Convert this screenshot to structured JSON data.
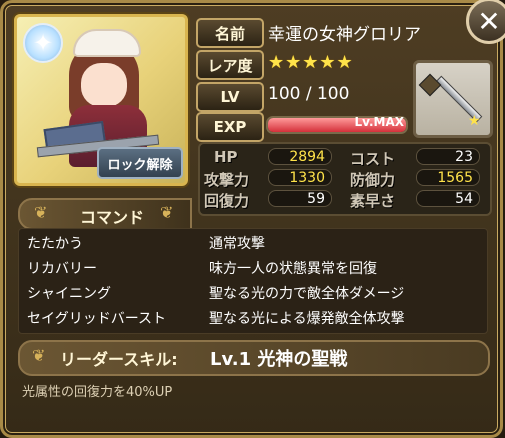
{
  "labels": {
    "name": "名前",
    "rarity": "レア度",
    "level": "LV",
    "exp": "EXP"
  },
  "card": {
    "name": "幸運の女神グロリア",
    "rarity_stars": "★★★★★",
    "level": "100 / 100",
    "exp_text": "Lv.MAX",
    "exp_progress": 1.0
  },
  "lock_button": "ロック解除",
  "stats": [
    {
      "label": "HP",
      "value": "2894",
      "highlight": true
    },
    {
      "label": "コスト",
      "value": "23",
      "highlight": false
    },
    {
      "label": "攻撃力",
      "value": "1330",
      "highlight": true
    },
    {
      "label": "防御力",
      "value": "1565",
      "highlight": true
    },
    {
      "label": "回復力",
      "value": "59",
      "highlight": false
    },
    {
      "label": "素早さ",
      "value": "54",
      "highlight": false
    }
  ],
  "command": {
    "title": "コマンド",
    "rows": [
      {
        "name": "たたかう",
        "desc": "通常攻撃"
      },
      {
        "name": "リカバリー",
        "desc": "味方一人の状態異常を回復"
      },
      {
        "name": "シャイニング",
        "desc": "聖なる光の力で敵全体ダメージ"
      },
      {
        "name": "セイグリッドバースト",
        "desc": "聖なる光による爆発敵全体攻撃"
      }
    ]
  },
  "leader": {
    "label": "リーダースキル:",
    "skill": "Lv.1 光神の聖戦",
    "desc": "光属性の回復力を40%UP"
  },
  "icons": {
    "close": "close-icon",
    "weapon": "sword-icon",
    "deco": "ornament-icon",
    "badge": "star-badge-icon"
  },
  "colors": {
    "gold": "#d9b54f",
    "exp_bar": "#d4303a",
    "highlight": "#ffe34a"
  }
}
